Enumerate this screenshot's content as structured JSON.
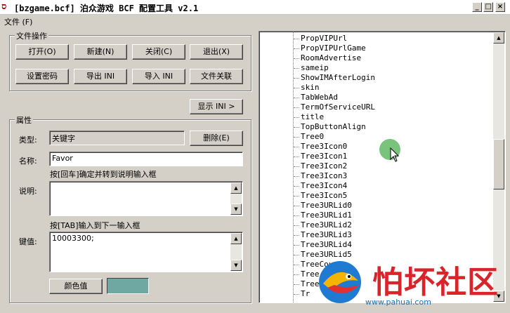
{
  "window": {
    "title": "[bzgame.bcf] 泊众游戏 BCF 配置工具 v2.1",
    "controls": [
      "_",
      "□",
      "×"
    ]
  },
  "menu": [
    {
      "label": "文件 (F)"
    }
  ],
  "file_ops": {
    "group_label": "文件操作",
    "buttons": {
      "open": "打开(O)",
      "new": "新建(N)",
      "close": "关闭(C)",
      "exit": "退出(X)",
      "set_password": "设置密码",
      "export_ini": "导出 INI",
      "import_ini": "导入 INI",
      "file_assoc": "文件关联"
    }
  },
  "show_ini_button": "显示 INI >",
  "properties": {
    "group_label": "属性",
    "type_label": "类型:",
    "type_value": "关键字",
    "delete_button": "删除(E)",
    "name_label": "名称:",
    "name_value": "Favor",
    "hint_enter": "按[回车]确定并转到说明输入框",
    "desc_label": "说明:",
    "desc_value": "",
    "hint_tab": "按[TAB]输入到下一输入框",
    "value_label": "键值:",
    "value_value": "10003300;",
    "color_button": "颜色值",
    "color_swatch": "#6fa8a2"
  },
  "tree": {
    "items": [
      "PropVIPUrl",
      "PropVIPUrlGame",
      "RoomAdvertise",
      "sameip",
      "ShowIMAfterLogin",
      "skin",
      "TabWebAd",
      "TermOfServiceURL",
      "title",
      "TopButtonAlign",
      "Tree0",
      "Tree3Icon0",
      "Tree3Icon1",
      "Tree3Icon2",
      "Tree3Icon3",
      "Tree3Icon4",
      "Tree3Icon5",
      "Tree3URLid0",
      "Tree3URLid1",
      "Tree3URLid2",
      "Tree3URLid3",
      "Tree3URLid4",
      "Tree3URLid5",
      "TreeCount",
      "Tree",
      "Tree",
      "Tr"
    ]
  },
  "watermark": {
    "text": "怕坏社区",
    "url": "www.pahuai.com"
  }
}
